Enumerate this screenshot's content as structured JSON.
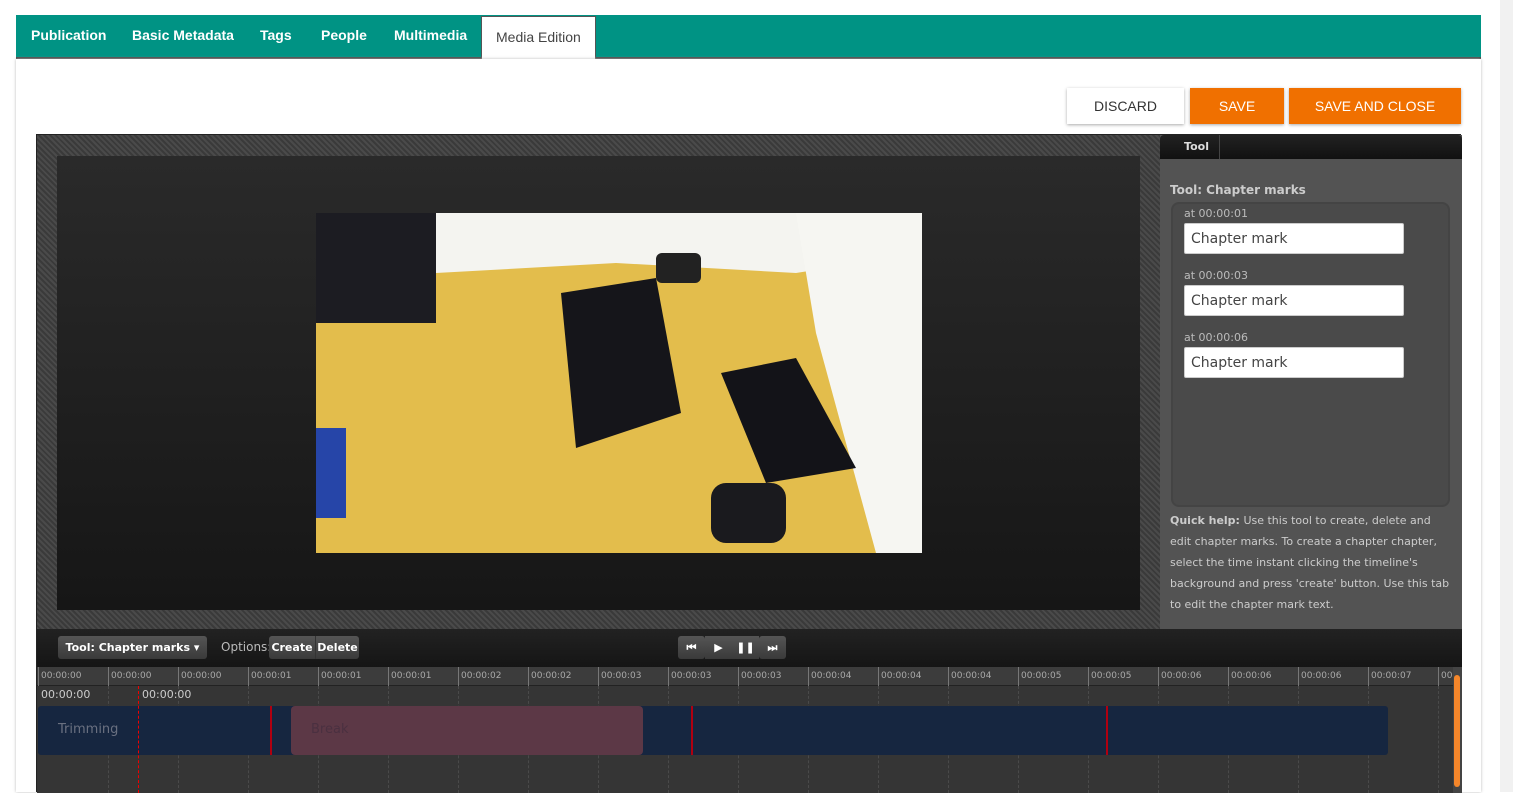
{
  "tabs": [
    "Publication",
    "Basic Metadata",
    "Tags",
    "People",
    "Multimedia",
    "Media Edition"
  ],
  "active_tab": "Media Edition",
  "actions": {
    "discard": "DISCARD",
    "save": "SAVE",
    "save_close": "SAVE AND CLOSE"
  },
  "colors": {
    "header": "#009384",
    "accent": "#f07000"
  },
  "side": {
    "tab": "Tool",
    "title": "Tool: Chapter marks",
    "marks": [
      {
        "time": "at 00:00:01",
        "value": "Chapter mark"
      },
      {
        "time": "at 00:00:03",
        "value": "Chapter mark"
      },
      {
        "time": "at 00:00:06",
        "value": "Chapter mark"
      }
    ],
    "help_bold": "Quick help:",
    "help": " Use this tool to create, delete and edit chapter marks. To create a chapter chapter, select the time instant clicking the timeline's background and press 'create' button. Use this tab to edit the chapter mark text."
  },
  "toolbar": {
    "tool": "Tool: Chapter marks",
    "options": "Options:",
    "create": "Create",
    "delete": "Delete"
  },
  "timeline": {
    "ticks": [
      "00:00:00",
      "00:00:00",
      "00:00:00",
      "00:00:01",
      "00:00:01",
      "00:00:01",
      "00:00:02",
      "00:00:02",
      "00:00:03",
      "00:00:03",
      "00:00:03",
      "00:00:04",
      "00:00:04",
      "00:00:04",
      "00:00:05",
      "00:00:05",
      "00:00:06",
      "00:00:06",
      "00:00:06",
      "00:00:07",
      "00:0"
    ],
    "start": "00:00:00",
    "cursor": "00:00:00",
    "trim_label": "Trimming",
    "break_label": "Break"
  }
}
